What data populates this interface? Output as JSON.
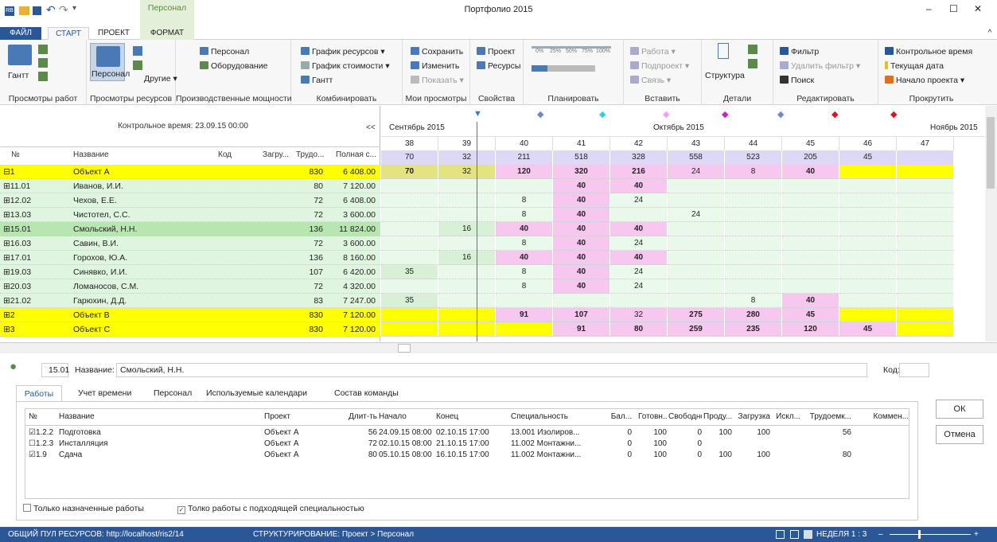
{
  "window": {
    "title": "Портфолио 2015",
    "context_tab": "Персонал",
    "min": "–",
    "max": "☐",
    "close": "✕",
    "collapse": "^"
  },
  "tabs": [
    "ФАЙЛ",
    "СТАРТ",
    "ПРОЕКТ",
    "ФОРМАТ"
  ],
  "ribbon": {
    "groups": [
      "Просмотры работ",
      "Просмотры ресурсов",
      "Производственные мощности",
      "Комбинировать",
      "Мои просмотры",
      "Свойства",
      "Планировать",
      "Вставить",
      "Детали",
      "Редактировать",
      "Прокрутить"
    ],
    "gantt": "Гантт",
    "personal": "Персонал",
    "others": "Другие ▾",
    "cap1": "Персонал",
    "cap2": "Оборудование",
    "comb1": "График ресурсов ▾",
    "comb2": "График стоимости ▾",
    "comb3": "Гантт",
    "my1": "Сохранить",
    "my2": "Изменить",
    "my3": "Показать ▾",
    "prop1": "Проект",
    "prop2": "Ресурсы",
    "plan_pcts": [
      "0%",
      "25%",
      "50%",
      "75%",
      "100%"
    ],
    "ins1": "Работа ▾",
    "ins2": "Подпроект ▾",
    "ins3": "Связь ▾",
    "det": "Структура",
    "ed1": "Фильтр",
    "ed2": "Удалить фильтр ▾",
    "ed3": "Поиск",
    "sc1": "Контрольное время",
    "sc2": "Текущая дата",
    "sc3": "Начало проекта ▾"
  },
  "grid": {
    "baseline": "Контрольное время: 23.09.15 00:00",
    "collapse": "<<",
    "cols": [
      "№",
      "Название",
      "Код",
      "Загру...",
      "Трудо...",
      "Полная с..."
    ],
    "rows": [
      {
        "no": "⊟1",
        "name": "Объект А",
        "code": "",
        "load": "",
        "work": "830",
        "cost": "6 408.00",
        "style": "obj"
      },
      {
        "no": "⊞11.01",
        "name": "Иванов, И.И.",
        "code": "",
        "load": "",
        "work": "80",
        "cost": "7 120.00",
        "style": "p"
      },
      {
        "no": "⊞12.02",
        "name": "Чехов, Е.Е.",
        "code": "",
        "load": "",
        "work": "72",
        "cost": "6 408.00",
        "style": "p"
      },
      {
        "no": "⊞13.03",
        "name": "Чистотел, С.С.",
        "code": "",
        "load": "",
        "work": "72",
        "cost": "3 600.00",
        "style": "p"
      },
      {
        "no": "⊞15.01",
        "name": "Смольский, Н.Н.",
        "code": "",
        "load": "",
        "work": "136",
        "cost": "11 824.00",
        "style": "sel"
      },
      {
        "no": "⊞16.03",
        "name": "Савин, В.И.",
        "code": "",
        "load": "",
        "work": "72",
        "cost": "3 600.00",
        "style": "p"
      },
      {
        "no": "⊞17.01",
        "name": "Горохов, Ю.А.",
        "code": "",
        "load": "",
        "work": "136",
        "cost": "8 160.00",
        "style": "p"
      },
      {
        "no": "⊞19.03",
        "name": "Синявко, И.И.",
        "code": "",
        "load": "",
        "work": "107",
        "cost": "6 420.00",
        "style": "p"
      },
      {
        "no": "⊞20.03",
        "name": "Ломаносов, С.М.",
        "code": "",
        "load": "",
        "work": "72",
        "cost": "4 320.00",
        "style": "p"
      },
      {
        "no": "⊞21.02",
        "name": "Гарюхин, Д.Д.",
        "code": "",
        "load": "",
        "work": "83",
        "cost": "7 247.00",
        "style": "p"
      },
      {
        "no": "⊞2",
        "name": "Объект В",
        "code": "",
        "load": "",
        "work": "830",
        "cost": "7 120.00",
        "style": "obj"
      },
      {
        "no": "⊞3",
        "name": "Объект С",
        "code": "",
        "load": "",
        "work": "830",
        "cost": "7 120.00",
        "style": "obj"
      }
    ]
  },
  "timeline": {
    "months": [
      "Сентябрь 2015",
      "Октябрь 2015",
      "Ноябрь 2015"
    ],
    "weeks": [
      "38",
      "39",
      "40",
      "41",
      "42",
      "43",
      "44",
      "45",
      "46",
      "47"
    ],
    "totals": [
      "70",
      "32",
      "211",
      "518",
      "328",
      "558",
      "523",
      "205",
      "45",
      ""
    ],
    "cells": [
      [
        "70",
        "32",
        "120",
        "320",
        "216",
        "24",
        "8",
        "40",
        "",
        ""
      ],
      [
        "",
        "",
        "",
        "40",
        "40",
        "",
        "",
        "",
        "",
        ""
      ],
      [
        "",
        "",
        "8",
        "40",
        "24",
        "",
        "",
        "",
        "",
        ""
      ],
      [
        "",
        "",
        "8",
        "40",
        "",
        "24",
        "",
        "",
        "",
        ""
      ],
      [
        "",
        "16",
        "40",
        "40",
        "40",
        "",
        "",
        "",
        "",
        ""
      ],
      [
        "",
        "",
        "8",
        "40",
        "24",
        "",
        "",
        "",
        "",
        ""
      ],
      [
        "",
        "16",
        "40",
        "40",
        "40",
        "",
        "",
        "",
        "",
        ""
      ],
      [
        "35",
        "",
        "8",
        "40",
        "24",
        "",
        "",
        "",
        "",
        ""
      ],
      [
        "",
        "",
        "8",
        "40",
        "24",
        "",
        "",
        "",
        "",
        ""
      ],
      [
        "35",
        "",
        "",
        "",
        "",
        "",
        "8",
        "40",
        "",
        ""
      ],
      [
        "",
        "",
        "91",
        "107",
        "32",
        "275",
        "280",
        "45",
        "",
        ""
      ],
      [
        "",
        "",
        "",
        "91",
        "80",
        "259",
        "235",
        "120",
        "45",
        ""
      ]
    ],
    "markers": [
      "▼",
      "◆",
      "◆",
      "◆",
      "◆",
      "◆",
      "◆",
      "◆"
    ]
  },
  "detail": {
    "id": "15.01",
    "name_label": "Название:",
    "name": "Смольский, Н.Н.",
    "code_label": "Код:",
    "tabs": [
      "Работы",
      "Учет времени",
      "Персонал",
      "Используемые календари",
      "Состав команды"
    ],
    "cols": [
      "№",
      "Название",
      "Проект",
      "Длит-ть",
      "Начало",
      "Конец",
      "Специальность",
      "Бал...",
      "Готовн...",
      "Свободно",
      "Проду...",
      "Загрузка",
      "Искл...",
      "Трудоемк...",
      "Коммен..."
    ],
    "rows": [
      [
        "1.2.2",
        "Подготовка",
        "Объект А",
        "56",
        "24.09.15 08:00",
        "02.10.15 17:00",
        "13.001 Изолиров...",
        "0",
        "100",
        "0",
        "100",
        "100",
        "",
        "56",
        ""
      ],
      [
        "1.2.3",
        "Инсталляция",
        "Объект А",
        "72",
        "02.10.15 08:00",
        "21.10.15 17:00",
        "11.002 Монтажни...",
        "0",
        "100",
        "0",
        "",
        "",
        "",
        "",
        ""
      ],
      [
        "1.9",
        "Сдача",
        "Объект А",
        "80",
        "05.10.15 08:00",
        "16.10.15 17:00",
        "11.002 Монтажни...",
        "0",
        "100",
        "0",
        "100",
        "100",
        "",
        "80",
        ""
      ]
    ],
    "chk1": "Только назначенные работы",
    "chk2": "Толко работы с подходящей специальностью",
    "ok": "ОК",
    "cancel": "Отмена"
  },
  "status": {
    "left": "ОБЩИЙ ПУЛ РЕСУРСОВ: http://localhost/ris2/14",
    "mid": "СТРУКТУРИРОВАНИЕ: Проект > Персонал",
    "zoom": "НЕДЕЛЯ 1 : 3"
  }
}
